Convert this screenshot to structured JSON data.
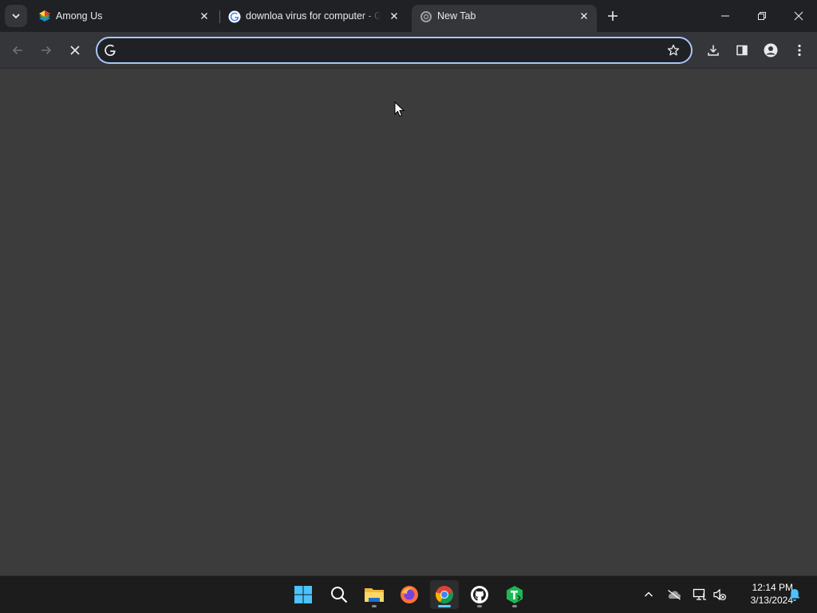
{
  "browser": {
    "tabs": [
      {
        "title": "Among Us",
        "favicon": "bluestacks-icon",
        "active": false
      },
      {
        "title": "downloa virus for computer - G",
        "favicon": "google-g-icon",
        "active": false
      },
      {
        "title": "New Tab",
        "favicon": "loading-spinner-icon",
        "active": true
      }
    ],
    "omnibox": {
      "value": "",
      "placeholder": ""
    },
    "accent": "#a8c7fa"
  },
  "taskbar": {
    "apps": [
      {
        "name": "start-button",
        "icon": "windows-logo-icon"
      },
      {
        "name": "search-button",
        "icon": "search-icon"
      },
      {
        "name": "file-explorer",
        "icon": "folder-icon"
      },
      {
        "name": "firefox",
        "icon": "firefox-icon"
      },
      {
        "name": "chrome",
        "icon": "chrome-icon"
      },
      {
        "name": "github-desktop",
        "icon": "github-icon"
      },
      {
        "name": "app-t",
        "icon": "green-t-icon"
      }
    ],
    "time": "12:14 PM",
    "date": "3/13/2024"
  }
}
